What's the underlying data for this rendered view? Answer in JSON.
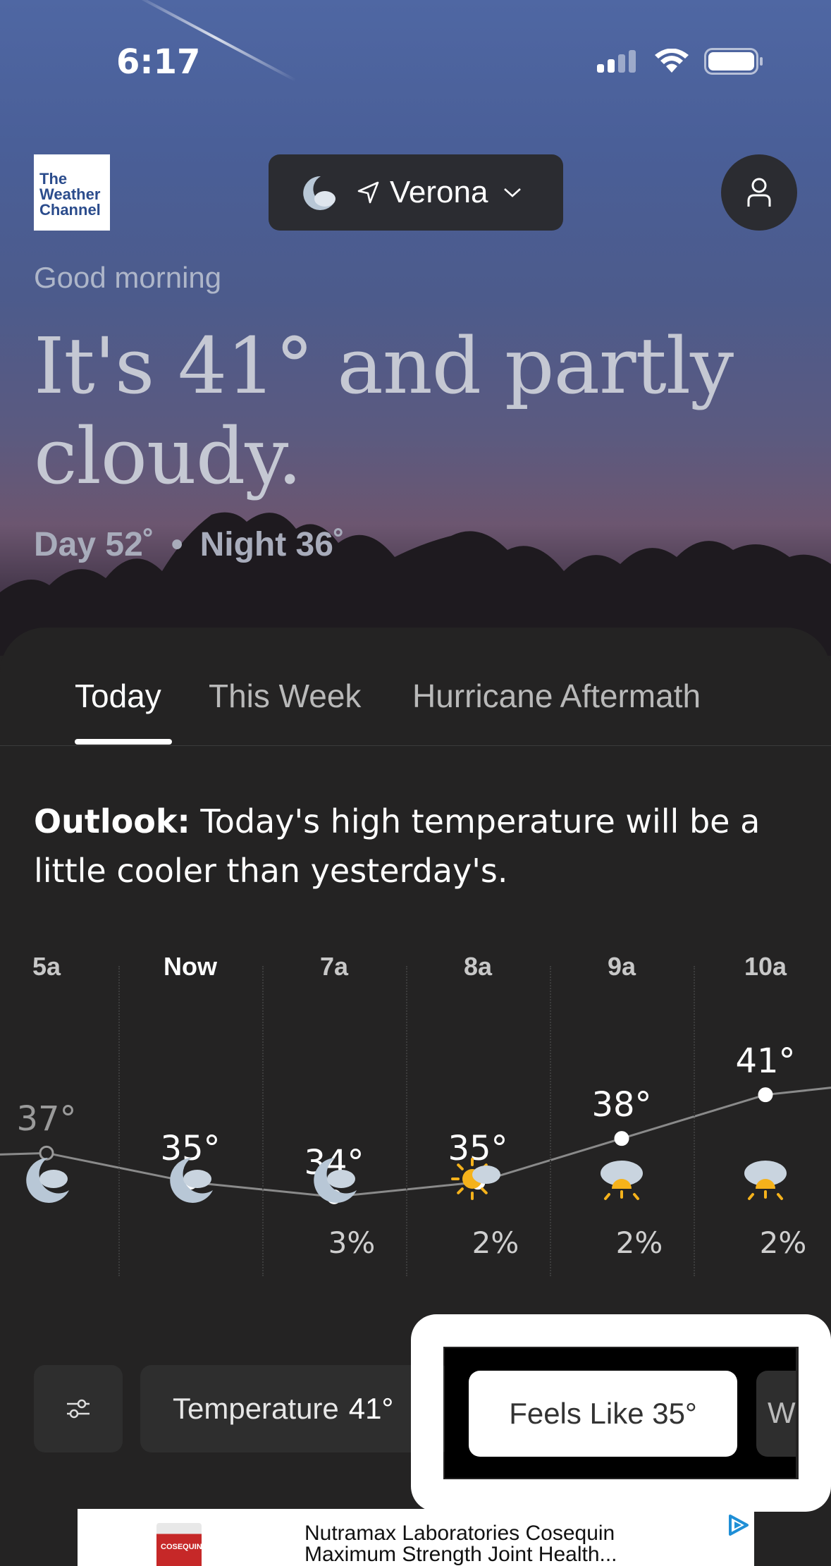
{
  "status_bar": {
    "time": "6:17"
  },
  "header": {
    "logo_lines": [
      "The",
      "Weather",
      "Channel"
    ],
    "location": "Verona"
  },
  "hero": {
    "greeting": "Good morning",
    "headline": "It's 41° and partly cloudy.",
    "day": "Day 52˚",
    "dot": "•",
    "night": "Night 36˚"
  },
  "tabs": [
    {
      "label": "Today",
      "active": true
    },
    {
      "label": "This Week",
      "active": false
    },
    {
      "label": "Hurricane Aftermath",
      "active": false
    }
  ],
  "outlook": {
    "label": "Outlook:",
    "text": " Today's high temperature will be a little cooler than yesterday's."
  },
  "hourly": [
    {
      "time": "5a",
      "temp": "37°",
      "icon": "moon-cloud-icon",
      "precip": ""
    },
    {
      "time": "Now",
      "temp": "35°",
      "icon": "moon-cloud-icon",
      "precip": ""
    },
    {
      "time": "7a",
      "temp": "34°",
      "icon": "moon-cloud-icon",
      "precip": "3%"
    },
    {
      "time": "8a",
      "temp": "35°",
      "icon": "sun-cloud-icon",
      "precip": "2%"
    },
    {
      "time": "9a",
      "temp": "38°",
      "icon": "cloud-sunrise-icon",
      "precip": "2%"
    },
    {
      "time": "10a",
      "temp": "41°",
      "icon": "cloud-sunrise-icon",
      "precip": "2%"
    }
  ],
  "metrics": {
    "temperature_label": "Temperature",
    "temperature_value": "41°",
    "feels_like_label": "Feels Like",
    "feels_like_value": "35°",
    "next_chip_partial": "W"
  },
  "ad": {
    "title_line1": "Nutramax Laboratories Cosequin",
    "title_line2": "Maximum Strength Joint Health...",
    "product_label": "COSEQUIN"
  },
  "colors": {
    "sheet_bg": "#242323",
    "chip_bg": "#2e2e2e",
    "sun_yellow": "#f5b21b",
    "moon_gray": "#b8c7d6"
  }
}
